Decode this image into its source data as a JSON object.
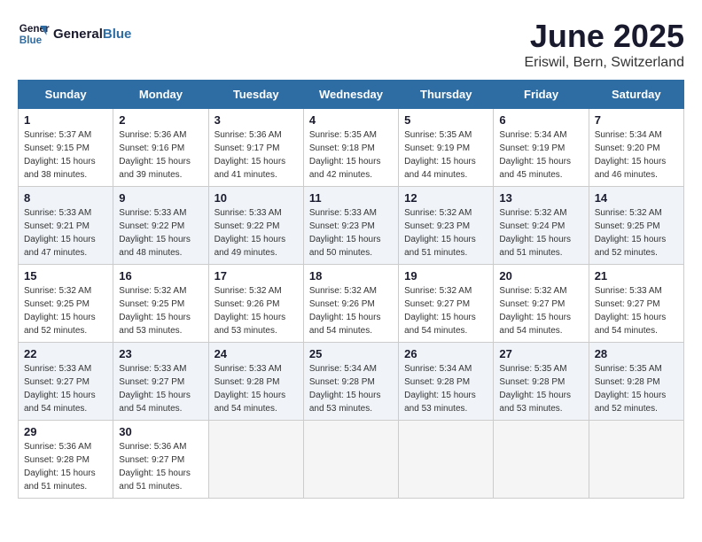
{
  "header": {
    "logo_line1": "General",
    "logo_line2": "Blue",
    "title": "June 2025",
    "subtitle": "Eriswil, Bern, Switzerland"
  },
  "calendar": {
    "columns": [
      "Sunday",
      "Monday",
      "Tuesday",
      "Wednesday",
      "Thursday",
      "Friday",
      "Saturday"
    ],
    "weeks": [
      [
        {
          "day": "",
          "empty": true
        },
        {
          "day": "",
          "empty": true
        },
        {
          "day": "",
          "empty": true
        },
        {
          "day": "",
          "empty": true
        },
        {
          "day": "",
          "empty": true
        },
        {
          "day": "",
          "empty": true
        },
        {
          "day": "",
          "empty": true
        }
      ],
      [
        {
          "day": "1",
          "sunrise": "Sunrise: 5:37 AM",
          "sunset": "Sunset: 9:15 PM",
          "daylight": "Daylight: 15 hours and 38 minutes."
        },
        {
          "day": "2",
          "sunrise": "Sunrise: 5:36 AM",
          "sunset": "Sunset: 9:16 PM",
          "daylight": "Daylight: 15 hours and 39 minutes."
        },
        {
          "day": "3",
          "sunrise": "Sunrise: 5:36 AM",
          "sunset": "Sunset: 9:17 PM",
          "daylight": "Daylight: 15 hours and 41 minutes."
        },
        {
          "day": "4",
          "sunrise": "Sunrise: 5:35 AM",
          "sunset": "Sunset: 9:18 PM",
          "daylight": "Daylight: 15 hours and 42 minutes."
        },
        {
          "day": "5",
          "sunrise": "Sunrise: 5:35 AM",
          "sunset": "Sunset: 9:19 PM",
          "daylight": "Daylight: 15 hours and 44 minutes."
        },
        {
          "day": "6",
          "sunrise": "Sunrise: 5:34 AM",
          "sunset": "Sunset: 9:19 PM",
          "daylight": "Daylight: 15 hours and 45 minutes."
        },
        {
          "day": "7",
          "sunrise": "Sunrise: 5:34 AM",
          "sunset": "Sunset: 9:20 PM",
          "daylight": "Daylight: 15 hours and 46 minutes."
        }
      ],
      [
        {
          "day": "8",
          "sunrise": "Sunrise: 5:33 AM",
          "sunset": "Sunset: 9:21 PM",
          "daylight": "Daylight: 15 hours and 47 minutes."
        },
        {
          "day": "9",
          "sunrise": "Sunrise: 5:33 AM",
          "sunset": "Sunset: 9:22 PM",
          "daylight": "Daylight: 15 hours and 48 minutes."
        },
        {
          "day": "10",
          "sunrise": "Sunrise: 5:33 AM",
          "sunset": "Sunset: 9:22 PM",
          "daylight": "Daylight: 15 hours and 49 minutes."
        },
        {
          "day": "11",
          "sunrise": "Sunrise: 5:33 AM",
          "sunset": "Sunset: 9:23 PM",
          "daylight": "Daylight: 15 hours and 50 minutes."
        },
        {
          "day": "12",
          "sunrise": "Sunrise: 5:32 AM",
          "sunset": "Sunset: 9:23 PM",
          "daylight": "Daylight: 15 hours and 51 minutes."
        },
        {
          "day": "13",
          "sunrise": "Sunrise: 5:32 AM",
          "sunset": "Sunset: 9:24 PM",
          "daylight": "Daylight: 15 hours and 51 minutes."
        },
        {
          "day": "14",
          "sunrise": "Sunrise: 5:32 AM",
          "sunset": "Sunset: 9:25 PM",
          "daylight": "Daylight: 15 hours and 52 minutes."
        }
      ],
      [
        {
          "day": "15",
          "sunrise": "Sunrise: 5:32 AM",
          "sunset": "Sunset: 9:25 PM",
          "daylight": "Daylight: 15 hours and 52 minutes."
        },
        {
          "day": "16",
          "sunrise": "Sunrise: 5:32 AM",
          "sunset": "Sunset: 9:25 PM",
          "daylight": "Daylight: 15 hours and 53 minutes."
        },
        {
          "day": "17",
          "sunrise": "Sunrise: 5:32 AM",
          "sunset": "Sunset: 9:26 PM",
          "daylight": "Daylight: 15 hours and 53 minutes."
        },
        {
          "day": "18",
          "sunrise": "Sunrise: 5:32 AM",
          "sunset": "Sunset: 9:26 PM",
          "daylight": "Daylight: 15 hours and 54 minutes."
        },
        {
          "day": "19",
          "sunrise": "Sunrise: 5:32 AM",
          "sunset": "Sunset: 9:27 PM",
          "daylight": "Daylight: 15 hours and 54 minutes."
        },
        {
          "day": "20",
          "sunrise": "Sunrise: 5:32 AM",
          "sunset": "Sunset: 9:27 PM",
          "daylight": "Daylight: 15 hours and 54 minutes."
        },
        {
          "day": "21",
          "sunrise": "Sunrise: 5:33 AM",
          "sunset": "Sunset: 9:27 PM",
          "daylight": "Daylight: 15 hours and 54 minutes."
        }
      ],
      [
        {
          "day": "22",
          "sunrise": "Sunrise: 5:33 AM",
          "sunset": "Sunset: 9:27 PM",
          "daylight": "Daylight: 15 hours and 54 minutes."
        },
        {
          "day": "23",
          "sunrise": "Sunrise: 5:33 AM",
          "sunset": "Sunset: 9:27 PM",
          "daylight": "Daylight: 15 hours and 54 minutes."
        },
        {
          "day": "24",
          "sunrise": "Sunrise: 5:33 AM",
          "sunset": "Sunset: 9:28 PM",
          "daylight": "Daylight: 15 hours and 54 minutes."
        },
        {
          "day": "25",
          "sunrise": "Sunrise: 5:34 AM",
          "sunset": "Sunset: 9:28 PM",
          "daylight": "Daylight: 15 hours and 53 minutes."
        },
        {
          "day": "26",
          "sunrise": "Sunrise: 5:34 AM",
          "sunset": "Sunset: 9:28 PM",
          "daylight": "Daylight: 15 hours and 53 minutes."
        },
        {
          "day": "27",
          "sunrise": "Sunrise: 5:35 AM",
          "sunset": "Sunset: 9:28 PM",
          "daylight": "Daylight: 15 hours and 53 minutes."
        },
        {
          "day": "28",
          "sunrise": "Sunrise: 5:35 AM",
          "sunset": "Sunset: 9:28 PM",
          "daylight": "Daylight: 15 hours and 52 minutes."
        }
      ],
      [
        {
          "day": "29",
          "sunrise": "Sunrise: 5:36 AM",
          "sunset": "Sunset: 9:28 PM",
          "daylight": "Daylight: 15 hours and 51 minutes."
        },
        {
          "day": "30",
          "sunrise": "Sunrise: 5:36 AM",
          "sunset": "Sunset: 9:27 PM",
          "daylight": "Daylight: 15 hours and 51 minutes."
        },
        {
          "day": "",
          "empty": true
        },
        {
          "day": "",
          "empty": true
        },
        {
          "day": "",
          "empty": true
        },
        {
          "day": "",
          "empty": true
        },
        {
          "day": "",
          "empty": true
        }
      ]
    ]
  }
}
